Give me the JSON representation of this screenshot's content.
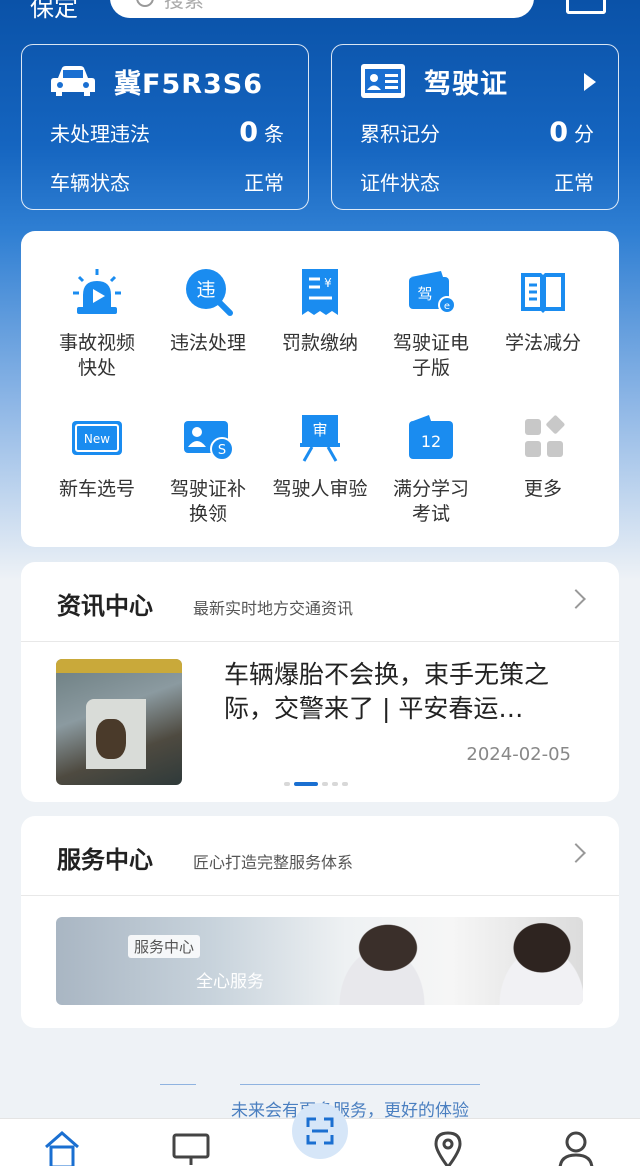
{
  "header": {
    "city": "保定",
    "search_placeholder": "搜索"
  },
  "vehicle_card": {
    "plate": "冀F5R3S6",
    "violations_label": "未处理违法",
    "violations_value": "0",
    "violations_unit": "条",
    "status_label": "车辆状态",
    "status_value": "正常"
  },
  "license_card": {
    "title": "驾驶证",
    "points_label": "累积记分",
    "points_value": "0",
    "points_unit": "分",
    "status_label": "证件状态",
    "status_value": "正常"
  },
  "services": [
    {
      "line1": "事故视频",
      "line2": "快处",
      "icon": "siren-icon"
    },
    {
      "line1": "违法处理",
      "line2": "",
      "icon": "violation-search-icon"
    },
    {
      "line1": "罚款缴纳",
      "line2": "",
      "icon": "fine-receipt-icon"
    },
    {
      "line1": "驾驶证电",
      "line2": "子版",
      "icon": "e-license-icon"
    },
    {
      "line1": "学法减分",
      "line2": "",
      "icon": "book-icon"
    },
    {
      "line1": "新车选号",
      "line2": "",
      "icon": "new-plate-icon"
    },
    {
      "line1": "驾驶证补",
      "line2": "换领",
      "icon": "license-renew-icon"
    },
    {
      "line1": "驾驶人审验",
      "line2": "",
      "icon": "review-icon"
    },
    {
      "line1": "满分学习",
      "line2": "考试",
      "icon": "calendar-exam-icon"
    },
    {
      "line1": "更多",
      "line2": "",
      "icon": "more-grid-icon"
    }
  ],
  "news": {
    "title": "资讯中心",
    "subtitle": "最新实时地方交通资讯",
    "article_title": "车辆爆胎不会换，束手无策之际，交警来了 | 平安春运…",
    "date": "2024-02-05"
  },
  "service_center": {
    "title": "服务中心",
    "subtitle": "匠心打造完整服务体系",
    "banner_tag": "服务中心",
    "banner_text": "全心服务"
  },
  "footer": {
    "text": "未来会有更多服务，更好的体验"
  },
  "colors": {
    "primary": "#1a6fd1",
    "hero_top": "#0a52a8"
  }
}
